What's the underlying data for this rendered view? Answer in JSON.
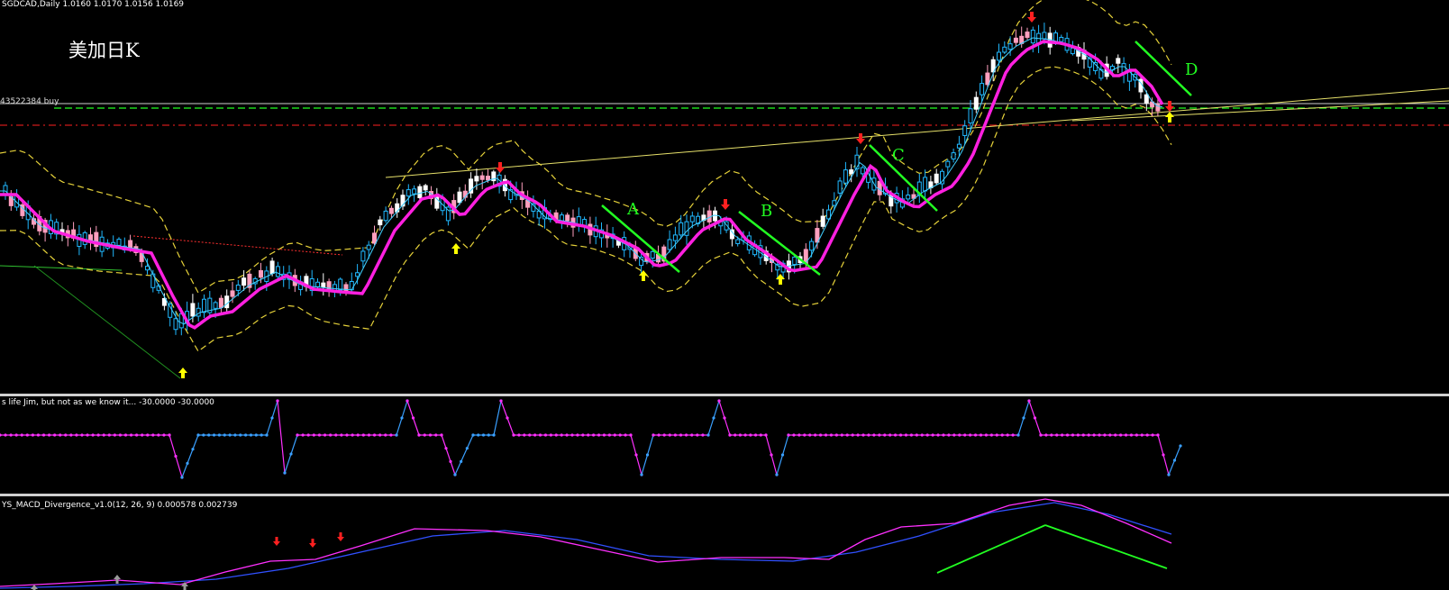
{
  "chart": {
    "symbol_info": "SGDCAD,Daily  1.0160 1.0170 1.0156 1.0169",
    "title": "美加日K",
    "level_label": "43522384 buy"
  },
  "wave_labels": [
    "A",
    "B",
    "C",
    "D"
  ],
  "indicators": {
    "oscillator_label": "s life Jim, but not as we know it...  -30.0000 -30.0000",
    "macd_label": "YS_MACD_Divergence_v1.0(12, 26, 9) 0.000578 0.002739"
  },
  "colors": {
    "background": "#000000",
    "bull_candle": "#20b8ff",
    "bear_candle": "#ffffff",
    "bear_candle_pink": "#ff9fbf",
    "ma_thick": "#ff20e0",
    "ma_thin": "#40d0ff",
    "envelope": "#e6d23a",
    "trendline": "#e6e06a",
    "wave_lines": "#22ff22",
    "arrow_up": "#ffff00",
    "arrow_down": "#ff2020",
    "level_green": "#22ff22",
    "level_red": "#ff2020",
    "osc_magenta": "#ff30ff",
    "osc_blue": "#3aa0ff",
    "macd_main": "#ff30ff",
    "macd_signal": "#3050ff"
  },
  "chart_data": {
    "type": "candlestick",
    "symbol": "SGDCAD",
    "timeframe": "Daily",
    "ohlc_last": {
      "open": 1.016,
      "high": 1.017,
      "low": 1.0156,
      "close": 1.0169
    }
  }
}
